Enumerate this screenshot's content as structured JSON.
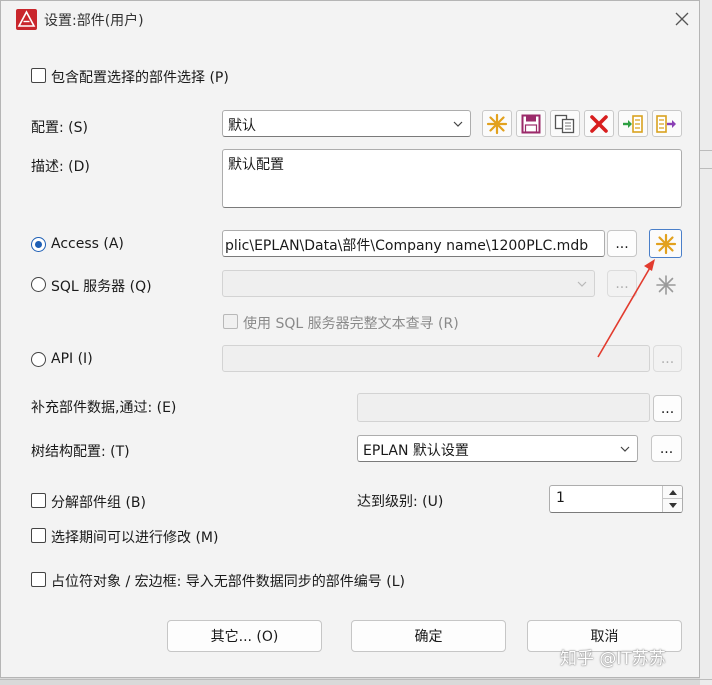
{
  "window": {
    "title": "设置:部件(用户)"
  },
  "options": {
    "include_config": "包含配置选择的部件选择 (P)"
  },
  "config": {
    "label": "配置: (S)",
    "value": "默认"
  },
  "description": {
    "label": "描述: (D)",
    "value": "默认配置"
  },
  "access": {
    "label": "Access (A)",
    "path": "plic\\EPLAN\\Data\\部件\\Company name\\1200PLC.mdb",
    "browse": "..."
  },
  "sql": {
    "label": "SQL 服务器 (Q)",
    "browse": "...",
    "fulltext": "使用 SQL 服务器完整文本查寻 (R)"
  },
  "api": {
    "label": "API (I)",
    "browse": "..."
  },
  "supplement": {
    "label": "补充部件数据,通过: (E)",
    "browse": "..."
  },
  "tree": {
    "label": "树结构配置: (T)",
    "value": "EPLAN 默认设置",
    "browse": "..."
  },
  "split": {
    "label": "分解部件组 (B)",
    "level_label": "达到级别: (U)",
    "level_value": "1"
  },
  "modify": {
    "label": "选择期间可以进行修改 (M)"
  },
  "placeholder": {
    "label": "占位符对象 / 宏边框: 导入无部件数据同步的部件编号 (L)"
  },
  "footer": {
    "other": "其它... (O)",
    "ok": "确定",
    "cancel": "取消"
  },
  "watermark": "知乎 @IT苏苏",
  "colors": {
    "accent": "#1e5fb5",
    "annotation_arrow": "#e23b2e"
  }
}
